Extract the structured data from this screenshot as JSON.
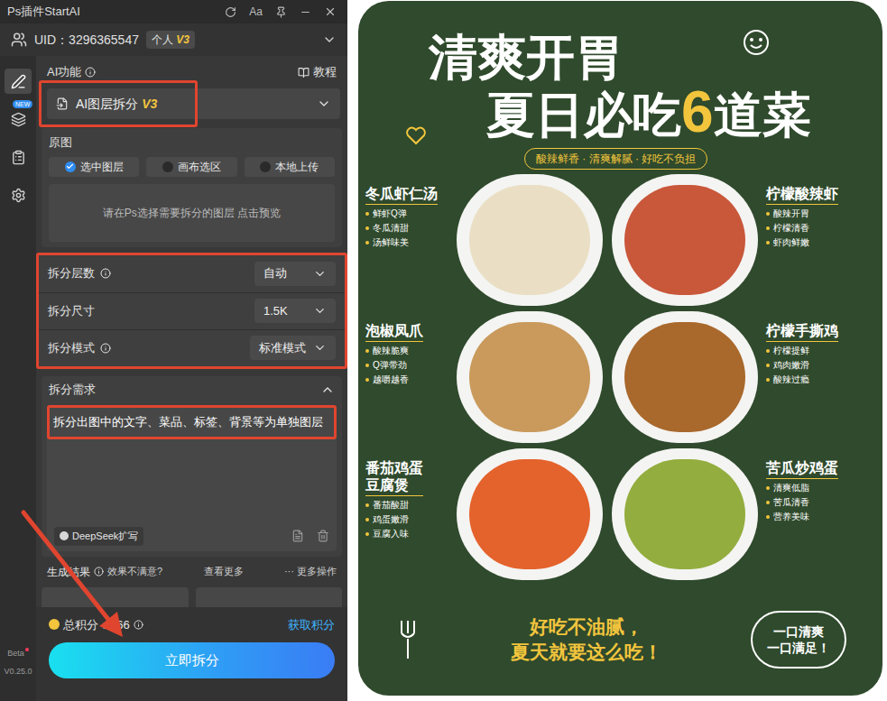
{
  "window": {
    "title": "Ps插件StartAI",
    "font_button": "Aa"
  },
  "user": {
    "uid": "UID：3296365547",
    "plan": "个人",
    "plan_level": "V3"
  },
  "rail": {
    "items": [
      {
        "selected": true,
        "badge": ""
      },
      {
        "selected": false,
        "badge": "NEW"
      },
      {
        "selected": false,
        "badge": ""
      },
      {
        "selected": false,
        "badge": ""
      }
    ]
  },
  "version": {
    "label": "Beta",
    "number": "V0.25.0"
  },
  "ai_function": {
    "label": "AI功能",
    "tutorial": "教程",
    "value": "AI图层拆分",
    "value_badge": "V3"
  },
  "source": {
    "label": "原图",
    "options": [
      {
        "label": "选中图层",
        "selected": true
      },
      {
        "label": "画布选区",
        "selected": false
      },
      {
        "label": "本地上传",
        "selected": false
      }
    ],
    "preview_hint": "请在Ps选择需要拆分的图层 点击预览"
  },
  "settings": [
    {
      "label": "拆分层数",
      "info": true,
      "value": "自动"
    },
    {
      "label": "拆分尺寸",
      "info": false,
      "value": "1.5K"
    },
    {
      "label": "拆分模式",
      "info": true,
      "value": "标准模式"
    }
  ],
  "requirement": {
    "label": "拆分需求",
    "expanded": true,
    "text": "拆分出图中的文字、菜品、标签、背景等为单独图层",
    "expand_button": "DeepSeek扩写"
  },
  "results": {
    "label": "生成结果",
    "feedback": "效果不满意?",
    "view_more": "查看更多",
    "more_icon": "···",
    "more": "更多操作"
  },
  "points": {
    "label": "总积分：466",
    "get": "获取积分"
  },
  "action": "立即拆分",
  "poster": {
    "title_line1": "清爽开胃",
    "title_line2_a": "夏日必吃",
    "title_number": "6",
    "title_line2_b": "道菜",
    "subtitle": "酸辣鲜香 · 清爽解腻 · 好吃不负担",
    "rows": [
      [
        {
          "name_lines": [
            "冬瓜虾仁汤"
          ],
          "points": [
            "鲜虾Q弹",
            "冬瓜清甜",
            "汤鲜味美"
          ]
        },
        {
          "name_lines": [
            "柠檬酸辣虾"
          ],
          "points": [
            "酸辣开胃",
            "柠檬清香",
            "虾肉鲜嫩"
          ]
        }
      ],
      [
        {
          "name_lines": [
            "泡椒凤爪"
          ],
          "points": [
            "酸辣脆爽",
            "Q弹带劲",
            "越嚼越香"
          ]
        },
        {
          "name_lines": [
            "柠檬手撕鸡"
          ],
          "points": [
            "柠檬提鲜",
            "鸡肉嫩滑",
            "酸辣过瘾"
          ]
        }
      ],
      [
        {
          "name_lines": [
            "番茄鸡蛋",
            "豆腐煲"
          ],
          "points": [
            "番茄酸甜",
            "鸡蛋嫩滑",
            "豆腐入味"
          ]
        },
        {
          "name_lines": [
            "苦瓜炒鸡蛋"
          ],
          "points": [
            "清爽低脂",
            "苦瓜清香",
            "营养美味"
          ]
        }
      ]
    ],
    "slogan_lines": [
      "好吃不油腻，",
      "夏天就要这么吃！"
    ],
    "cloud_lines": [
      "一口清爽",
      "一口满足！"
    ]
  }
}
